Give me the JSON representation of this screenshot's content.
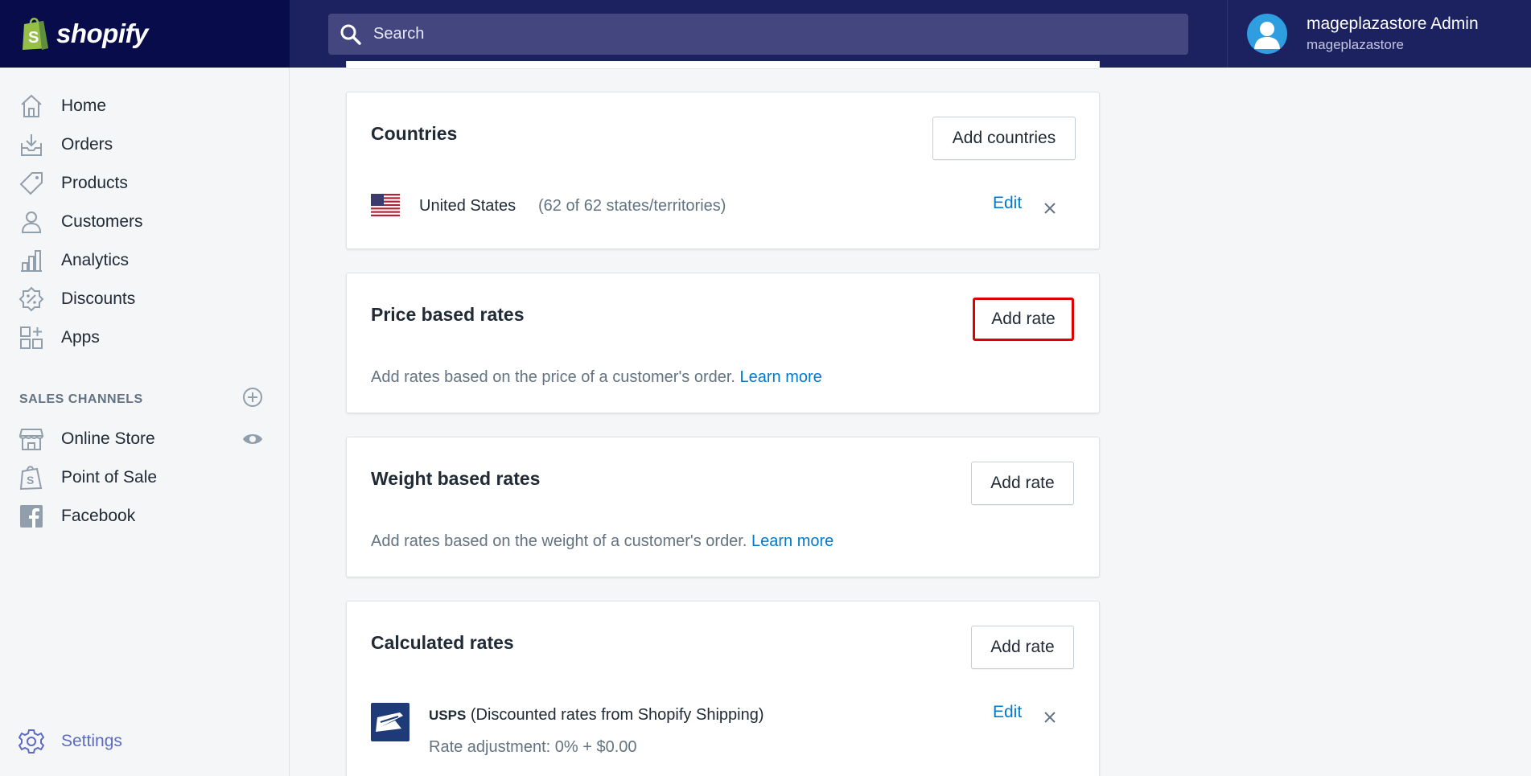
{
  "brand": {
    "name": "shopify"
  },
  "search": {
    "placeholder": "Search"
  },
  "user": {
    "name": "mageplazastore Admin",
    "store": "mageplazastore"
  },
  "sidebar": {
    "items": [
      {
        "label": "Home",
        "icon": "home-icon"
      },
      {
        "label": "Orders",
        "icon": "orders-icon"
      },
      {
        "label": "Products",
        "icon": "tag-icon"
      },
      {
        "label": "Customers",
        "icon": "person-icon"
      },
      {
        "label": "Analytics",
        "icon": "bar-chart-icon"
      },
      {
        "label": "Discounts",
        "icon": "discount-icon"
      },
      {
        "label": "Apps",
        "icon": "apps-icon"
      }
    ],
    "sales_channels_title": "SALES CHANNELS",
    "channels": [
      {
        "label": "Online Store",
        "icon": "store-icon"
      },
      {
        "label": "Point of Sale",
        "icon": "pos-bag-icon"
      },
      {
        "label": "Facebook",
        "icon": "facebook-icon"
      }
    ],
    "settings_label": "Settings",
    "accent_color": "#5c6ac4"
  },
  "countries_card": {
    "title": "Countries",
    "button_label": "Add countries",
    "country_name": "United States",
    "country_detail": "(62 of 62 states/territories)",
    "edit_label": "Edit"
  },
  "price_card": {
    "title": "Price based rates",
    "button_label": "Add rate",
    "description": "Add rates based on the price of a customer's order.",
    "link_label": "Learn more"
  },
  "weight_card": {
    "title": "Weight based rates",
    "button_label": "Add rate",
    "description": "Add rates based on the weight of a customer's order.",
    "link_label": "Learn more"
  },
  "calculated_card": {
    "title": "Calculated rates",
    "button_label": "Add rate",
    "carrier_name": "USPS",
    "carrier_detail": "(Discounted rates from Shopify Shipping)",
    "rate_adjustment": "Rate adjustment: 0% + $0.00",
    "edit_label": "Edit"
  },
  "colors": {
    "topbar": "#1c2260",
    "link": "#007ace",
    "highlight": "#e10000"
  }
}
